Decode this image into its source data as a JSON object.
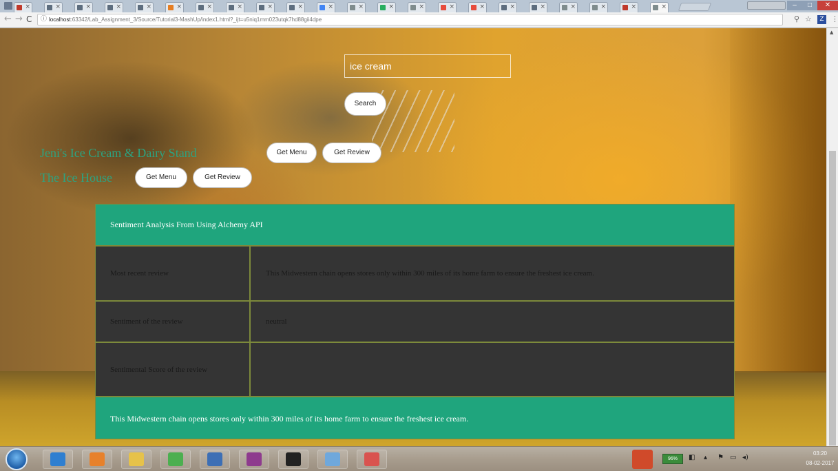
{
  "browser": {
    "tabs": [
      {
        "color": "#c0392b"
      },
      {
        "color": "#5d6d7e"
      },
      {
        "color": "#5d6d7e"
      },
      {
        "color": "#5d6d7e"
      },
      {
        "color": "#5d6d7e"
      },
      {
        "color": "#e67e22"
      },
      {
        "color": "#5d6d7e"
      },
      {
        "color": "#5d6d7e"
      },
      {
        "color": "#5d6d7e"
      },
      {
        "color": "#5d6d7e"
      },
      {
        "color": "#4285f4"
      },
      {
        "color": "#7f8c8d"
      },
      {
        "color": "#27ae60"
      },
      {
        "color": "#7f8c8d"
      },
      {
        "color": "#e74c3c"
      },
      {
        "color": "#e74c3c"
      },
      {
        "color": "#5d6d7e"
      },
      {
        "color": "#5d6d7e"
      },
      {
        "color": "#7f8c8d"
      },
      {
        "color": "#7f8c8d"
      },
      {
        "color": "#c0392b"
      },
      {
        "color": "#7f8c8d",
        "active": true
      }
    ],
    "address": {
      "host": "localhost",
      "path": ":63342/Lab_Assignment_3/Source/Tutorial3-MashUp/index1.html?_ijt=u5niq1mm023utqk7hd88gii4dpe"
    },
    "extension_label": "Z"
  },
  "page": {
    "search": {
      "value": "ice cream"
    },
    "search_button": "Search",
    "results": [
      {
        "name": "Jeni's Ice Cream & Dairy Stand",
        "menu_label": "Get Menu",
        "review_label": "Get Review"
      },
      {
        "name": "The Ice House",
        "menu_label": "Get Menu",
        "review_label": "Get Review"
      }
    ],
    "sentiment": {
      "header": "Sentiment Analysis From Using Alchemy API",
      "rows": [
        {
          "label": "Most recent review",
          "value": "This Midwestern chain opens stores only within 300 miles of its home farm to ensure the freshest ice cream."
        },
        {
          "label": "Sentiment of the review",
          "value": "neutral"
        },
        {
          "label": "Sentimental Score of the review",
          "value": ""
        }
      ],
      "footer": "This Midwestern chain opens stores only within 300 miles of its home farm to ensure the freshest ice cream."
    }
  },
  "taskbar": {
    "apps": [
      {
        "icon": "internet-explorer-icon",
        "color": "#2f7fd0"
      },
      {
        "icon": "media-player-icon",
        "color": "#e7812b"
      },
      {
        "icon": "file-explorer-icon",
        "color": "#e6c24a"
      },
      {
        "icon": "chrome-icon",
        "color": "#4caf50"
      },
      {
        "icon": "visual-studio-icon",
        "color": "#3d6fb5"
      },
      {
        "icon": "winrar-icon",
        "color": "#8e3b8e"
      },
      {
        "icon": "terminal-icon",
        "color": "#222222"
      },
      {
        "icon": "notepad-icon",
        "color": "#6fa8dc"
      },
      {
        "icon": "snipping-tool-icon",
        "color": "#d9534f"
      }
    ],
    "battery": "96%",
    "time": "03:20",
    "date": "08-02-2017"
  }
}
